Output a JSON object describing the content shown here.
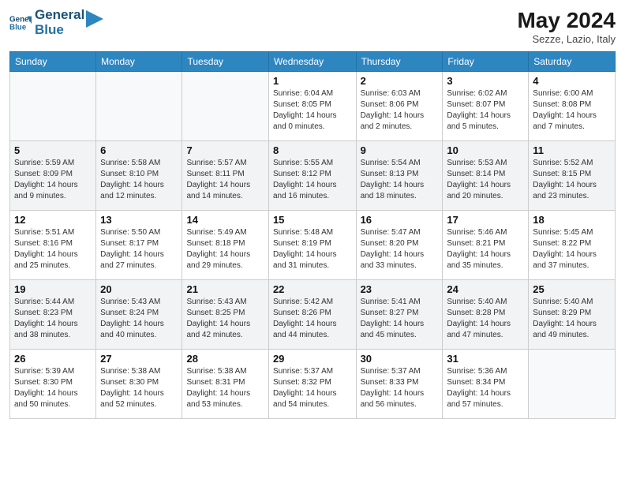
{
  "header": {
    "logo_line1": "General",
    "logo_line2": "Blue",
    "month_year": "May 2024",
    "location": "Sezze, Lazio, Italy"
  },
  "days_of_week": [
    "Sunday",
    "Monday",
    "Tuesday",
    "Wednesday",
    "Thursday",
    "Friday",
    "Saturday"
  ],
  "weeks": [
    [
      {
        "day": "",
        "info": ""
      },
      {
        "day": "",
        "info": ""
      },
      {
        "day": "",
        "info": ""
      },
      {
        "day": "1",
        "info": "Sunrise: 6:04 AM\nSunset: 8:05 PM\nDaylight: 14 hours\nand 0 minutes."
      },
      {
        "day": "2",
        "info": "Sunrise: 6:03 AM\nSunset: 8:06 PM\nDaylight: 14 hours\nand 2 minutes."
      },
      {
        "day": "3",
        "info": "Sunrise: 6:02 AM\nSunset: 8:07 PM\nDaylight: 14 hours\nand 5 minutes."
      },
      {
        "day": "4",
        "info": "Sunrise: 6:00 AM\nSunset: 8:08 PM\nDaylight: 14 hours\nand 7 minutes."
      }
    ],
    [
      {
        "day": "5",
        "info": "Sunrise: 5:59 AM\nSunset: 8:09 PM\nDaylight: 14 hours\nand 9 minutes."
      },
      {
        "day": "6",
        "info": "Sunrise: 5:58 AM\nSunset: 8:10 PM\nDaylight: 14 hours\nand 12 minutes."
      },
      {
        "day": "7",
        "info": "Sunrise: 5:57 AM\nSunset: 8:11 PM\nDaylight: 14 hours\nand 14 minutes."
      },
      {
        "day": "8",
        "info": "Sunrise: 5:55 AM\nSunset: 8:12 PM\nDaylight: 14 hours\nand 16 minutes."
      },
      {
        "day": "9",
        "info": "Sunrise: 5:54 AM\nSunset: 8:13 PM\nDaylight: 14 hours\nand 18 minutes."
      },
      {
        "day": "10",
        "info": "Sunrise: 5:53 AM\nSunset: 8:14 PM\nDaylight: 14 hours\nand 20 minutes."
      },
      {
        "day": "11",
        "info": "Sunrise: 5:52 AM\nSunset: 8:15 PM\nDaylight: 14 hours\nand 23 minutes."
      }
    ],
    [
      {
        "day": "12",
        "info": "Sunrise: 5:51 AM\nSunset: 8:16 PM\nDaylight: 14 hours\nand 25 minutes."
      },
      {
        "day": "13",
        "info": "Sunrise: 5:50 AM\nSunset: 8:17 PM\nDaylight: 14 hours\nand 27 minutes."
      },
      {
        "day": "14",
        "info": "Sunrise: 5:49 AM\nSunset: 8:18 PM\nDaylight: 14 hours\nand 29 minutes."
      },
      {
        "day": "15",
        "info": "Sunrise: 5:48 AM\nSunset: 8:19 PM\nDaylight: 14 hours\nand 31 minutes."
      },
      {
        "day": "16",
        "info": "Sunrise: 5:47 AM\nSunset: 8:20 PM\nDaylight: 14 hours\nand 33 minutes."
      },
      {
        "day": "17",
        "info": "Sunrise: 5:46 AM\nSunset: 8:21 PM\nDaylight: 14 hours\nand 35 minutes."
      },
      {
        "day": "18",
        "info": "Sunrise: 5:45 AM\nSunset: 8:22 PM\nDaylight: 14 hours\nand 37 minutes."
      }
    ],
    [
      {
        "day": "19",
        "info": "Sunrise: 5:44 AM\nSunset: 8:23 PM\nDaylight: 14 hours\nand 38 minutes."
      },
      {
        "day": "20",
        "info": "Sunrise: 5:43 AM\nSunset: 8:24 PM\nDaylight: 14 hours\nand 40 minutes."
      },
      {
        "day": "21",
        "info": "Sunrise: 5:43 AM\nSunset: 8:25 PM\nDaylight: 14 hours\nand 42 minutes."
      },
      {
        "day": "22",
        "info": "Sunrise: 5:42 AM\nSunset: 8:26 PM\nDaylight: 14 hours\nand 44 minutes."
      },
      {
        "day": "23",
        "info": "Sunrise: 5:41 AM\nSunset: 8:27 PM\nDaylight: 14 hours\nand 45 minutes."
      },
      {
        "day": "24",
        "info": "Sunrise: 5:40 AM\nSunset: 8:28 PM\nDaylight: 14 hours\nand 47 minutes."
      },
      {
        "day": "25",
        "info": "Sunrise: 5:40 AM\nSunset: 8:29 PM\nDaylight: 14 hours\nand 49 minutes."
      }
    ],
    [
      {
        "day": "26",
        "info": "Sunrise: 5:39 AM\nSunset: 8:30 PM\nDaylight: 14 hours\nand 50 minutes."
      },
      {
        "day": "27",
        "info": "Sunrise: 5:38 AM\nSunset: 8:30 PM\nDaylight: 14 hours\nand 52 minutes."
      },
      {
        "day": "28",
        "info": "Sunrise: 5:38 AM\nSunset: 8:31 PM\nDaylight: 14 hours\nand 53 minutes."
      },
      {
        "day": "29",
        "info": "Sunrise: 5:37 AM\nSunset: 8:32 PM\nDaylight: 14 hours\nand 54 minutes."
      },
      {
        "day": "30",
        "info": "Sunrise: 5:37 AM\nSunset: 8:33 PM\nDaylight: 14 hours\nand 56 minutes."
      },
      {
        "day": "31",
        "info": "Sunrise: 5:36 AM\nSunset: 8:34 PM\nDaylight: 14 hours\nand 57 minutes."
      },
      {
        "day": "",
        "info": ""
      }
    ]
  ]
}
